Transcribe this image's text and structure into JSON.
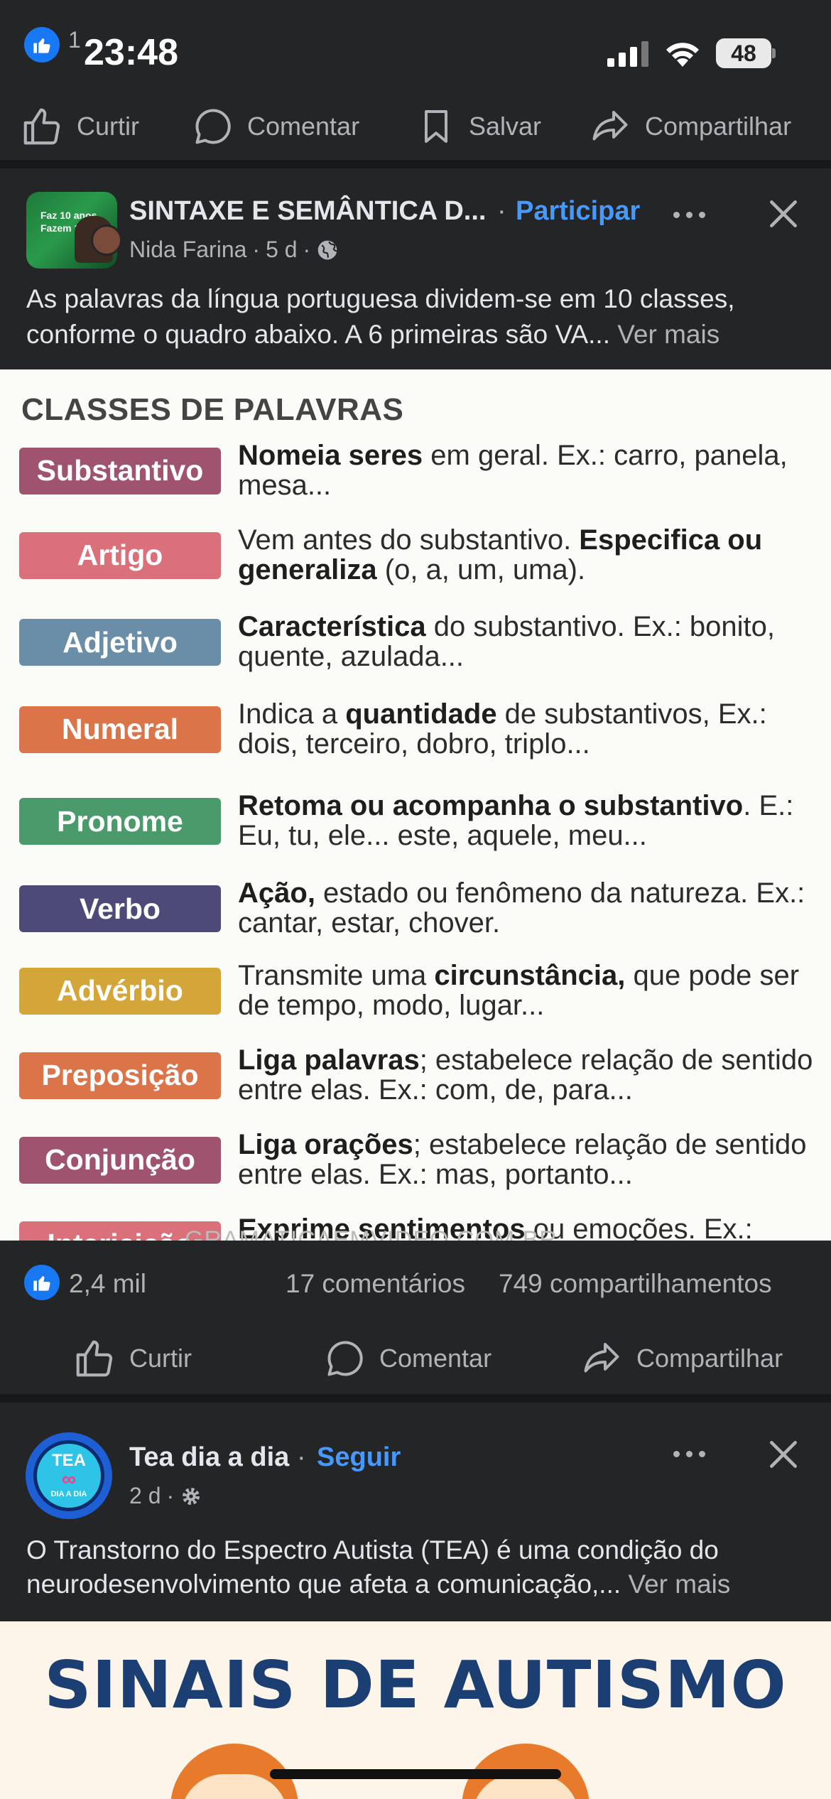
{
  "status_bar": {
    "notification_count": "1",
    "time": "23:48",
    "battery": "48"
  },
  "top_actions": {
    "like": "Curtir",
    "comment": "Comentar",
    "save": "Salvar",
    "share": "Compartilhar"
  },
  "post1": {
    "group_title": "SINTAXE E SEMÂNTICA D...",
    "separator": "·",
    "join_label": "Participar",
    "author": "Nida Farina",
    "age": "5 d",
    "text": "As palavras da língua portuguesa dividem-se em 10 classes, conforme o quadro abaixo. A 6 primeiras são VA...",
    "see_more": "Ver mais",
    "image": {
      "title": "CLASSES DE PALAVRAS",
      "watermark": "GRAMATICAEMVIDEO.COM.BR",
      "rows": [
        {
          "label": "Substantivo",
          "color": "#a0536f",
          "bold": "Nomeia seres",
          "rest": " em geral. Ex.: carro, panela, mesa..."
        },
        {
          "label": "Artigo",
          "color": "#d9707a",
          "pre": "Vem antes do substantivo. ",
          "bold": "Especifica ou generaliza",
          "rest": " (o, a, um, uma)."
        },
        {
          "label": "Adjetivo",
          "color": "#6a8ea8",
          "bold": "Característica",
          "rest": " do substantivo. Ex.: bonito, quente, azulada..."
        },
        {
          "label": "Numeral",
          "color": "#db7448",
          "pre": "Indica a ",
          "bold": "quantidade",
          "rest": " de substantivos, Ex.: dois, terceiro, dobro, triplo..."
        },
        {
          "label": "Pronome",
          "color": "#4a9a6c",
          "bold": "Retoma ou acompanha o substantivo",
          "rest": ". E.: Eu, tu, ele... este, aquele, meu..."
        },
        {
          "label": "Verbo",
          "color": "#4e4a78",
          "bold": "Ação,",
          "rest": " estado ou fenômeno da natureza. Ex.: cantar, estar, chover."
        },
        {
          "label": "Advérbio",
          "color": "#d4a63a",
          "pre": "Transmite uma ",
          "bold": "circunstância,",
          "rest": " que pode ser de tempo, modo, lugar..."
        },
        {
          "label": "Preposição",
          "color": "#db7448",
          "bold": "Liga palavras",
          "rest": "; estabelece relação de sentido entre elas.  Ex.: com, de, para..."
        },
        {
          "label": "Conjunção",
          "color": "#a0536f",
          "bold": "Liga orações",
          "rest": "; estabelece relação de sentido entre elas.  Ex.: mas, portanto..."
        },
        {
          "label": "Interjeição",
          "color": "#d9707a",
          "bold": "Exprime sentimentos",
          "rest": " ou emoções. Ex.: Oba! Ah! Credo!"
        }
      ]
    },
    "likes": "2,4 mil",
    "comments": "17 comentários",
    "shares": "749 compartilhamentos"
  },
  "post1_actions": {
    "like": "Curtir",
    "comment": "Comentar",
    "share": "Compartilhar"
  },
  "post2": {
    "page_name": "Tea dia a dia",
    "separator": "·",
    "follow_label": "Seguir",
    "age": "2 d",
    "avatar_text_top": "TEA",
    "avatar_text_bottom": "DIA A DIA",
    "text": "O Transtorno do Espectro Autista (TEA) é uma condição do neurodesenvolvimento que afeta a comunicação,...",
    "see_more": "Ver mais",
    "image_title": "SINAIS DE AUTISMO"
  },
  "colors": {
    "background": "#242526",
    "divider": "#18191a",
    "accent_blue": "#4599ff",
    "like_blue": "#1877f2",
    "muted_text": "#b0b3b8"
  }
}
